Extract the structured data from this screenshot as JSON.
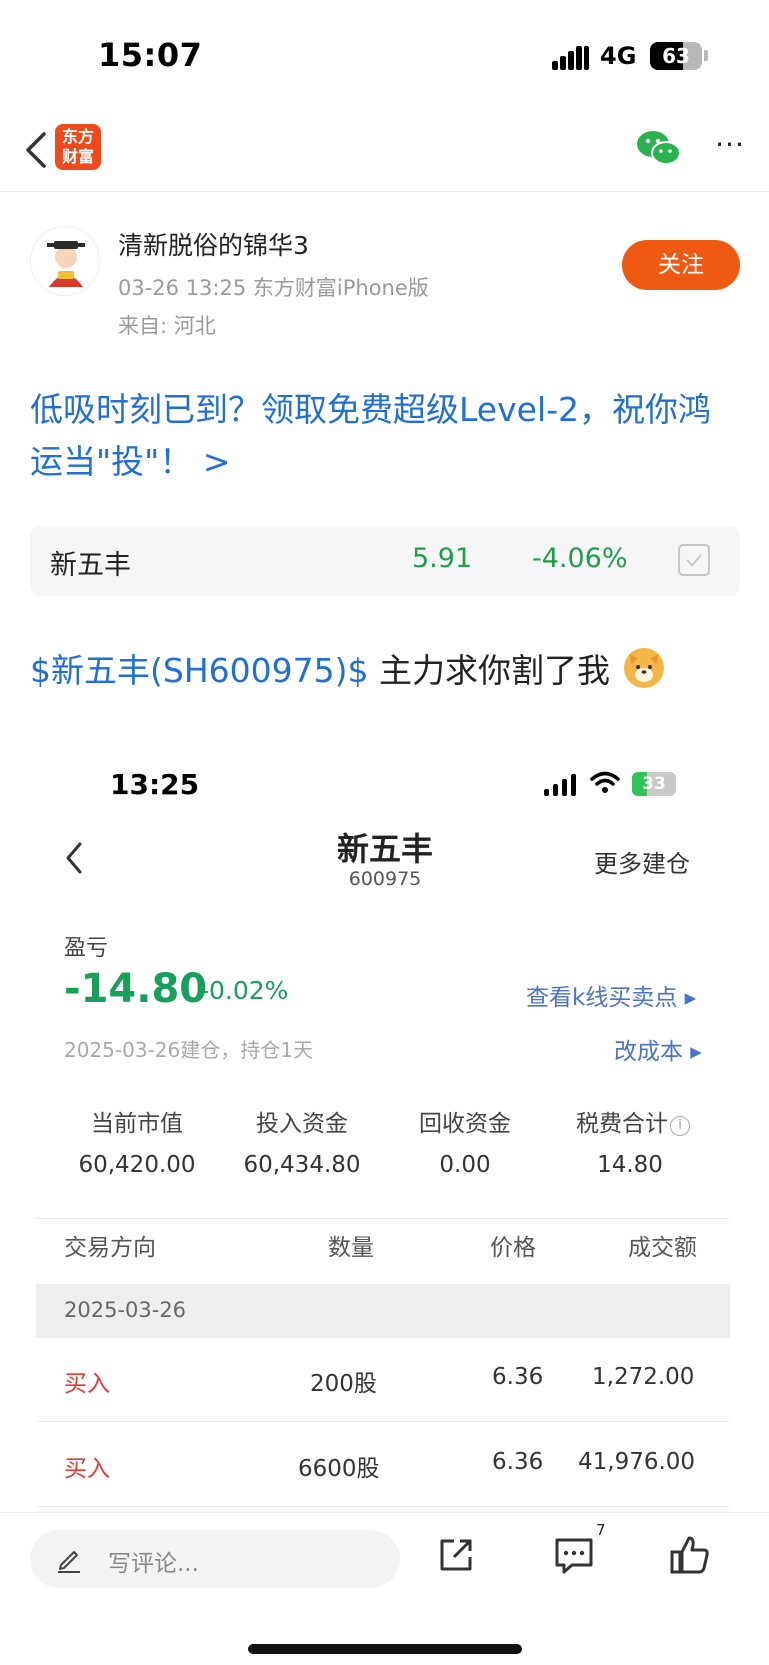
{
  "status_bar": {
    "time": "15:07",
    "network": "4G",
    "battery": "63",
    "battery_level": 0.63
  },
  "nav": {
    "logo_text": "东方\n财富",
    "more": "···"
  },
  "author": {
    "name": "清新脱俗的锦华3",
    "meta": "03-26 13:25 东方财富iPhone版",
    "from": "来自: 河北",
    "follow_label": "关注"
  },
  "promo": {
    "text": "低吸时刻已到？领取免费超级Level-2，祝你鸿运当\"投\"！ >"
  },
  "stock_card": {
    "name": "新五丰",
    "price": "5.91",
    "change_pct": "-4.06%",
    "price_color": "#1e9e4a"
  },
  "post": {
    "tag": "$新五丰(SH600975)$",
    "text": "主力求你割了我"
  },
  "screenshot": {
    "status": {
      "time": "13:25",
      "battery": "33",
      "battery_level": 0.33
    },
    "header": {
      "title": "新五丰",
      "code": "600975",
      "more": "更多建仓"
    },
    "pnl": {
      "label": "盈亏",
      "value": "-14.80",
      "pct": "-0.02%",
      "link_k": "查看k线买卖点 ▸",
      "hold_info": "2025-03-26建仓，持仓1天",
      "link_cost": "改成本 ▸"
    },
    "stats": [
      {
        "label": "当前市值",
        "value": "60,420.00"
      },
      {
        "label": "投入资金",
        "value": "60,434.80"
      },
      {
        "label": "回收资金",
        "value": "0.00"
      },
      {
        "label": "税费合计",
        "value": "14.80"
      }
    ],
    "table": {
      "headers": [
        "交易方向",
        "数量",
        "价格",
        "成交额"
      ],
      "date": "2025-03-26",
      "rows": [
        {
          "direction": "买入",
          "qty": "200股",
          "price": "6.36",
          "amount": "1,272.00"
        },
        {
          "direction": "买入",
          "qty": "6600股",
          "price": "6.36",
          "amount": "41,976.00"
        }
      ]
    }
  },
  "bottom_bar": {
    "comment_placeholder": "写评论...",
    "comment_count": "7"
  },
  "colors": {
    "accent_orange": "#ef5a12",
    "link_blue": "#1f6fd6",
    "down_green": "#17a05a",
    "buy_red": "#e53935"
  }
}
